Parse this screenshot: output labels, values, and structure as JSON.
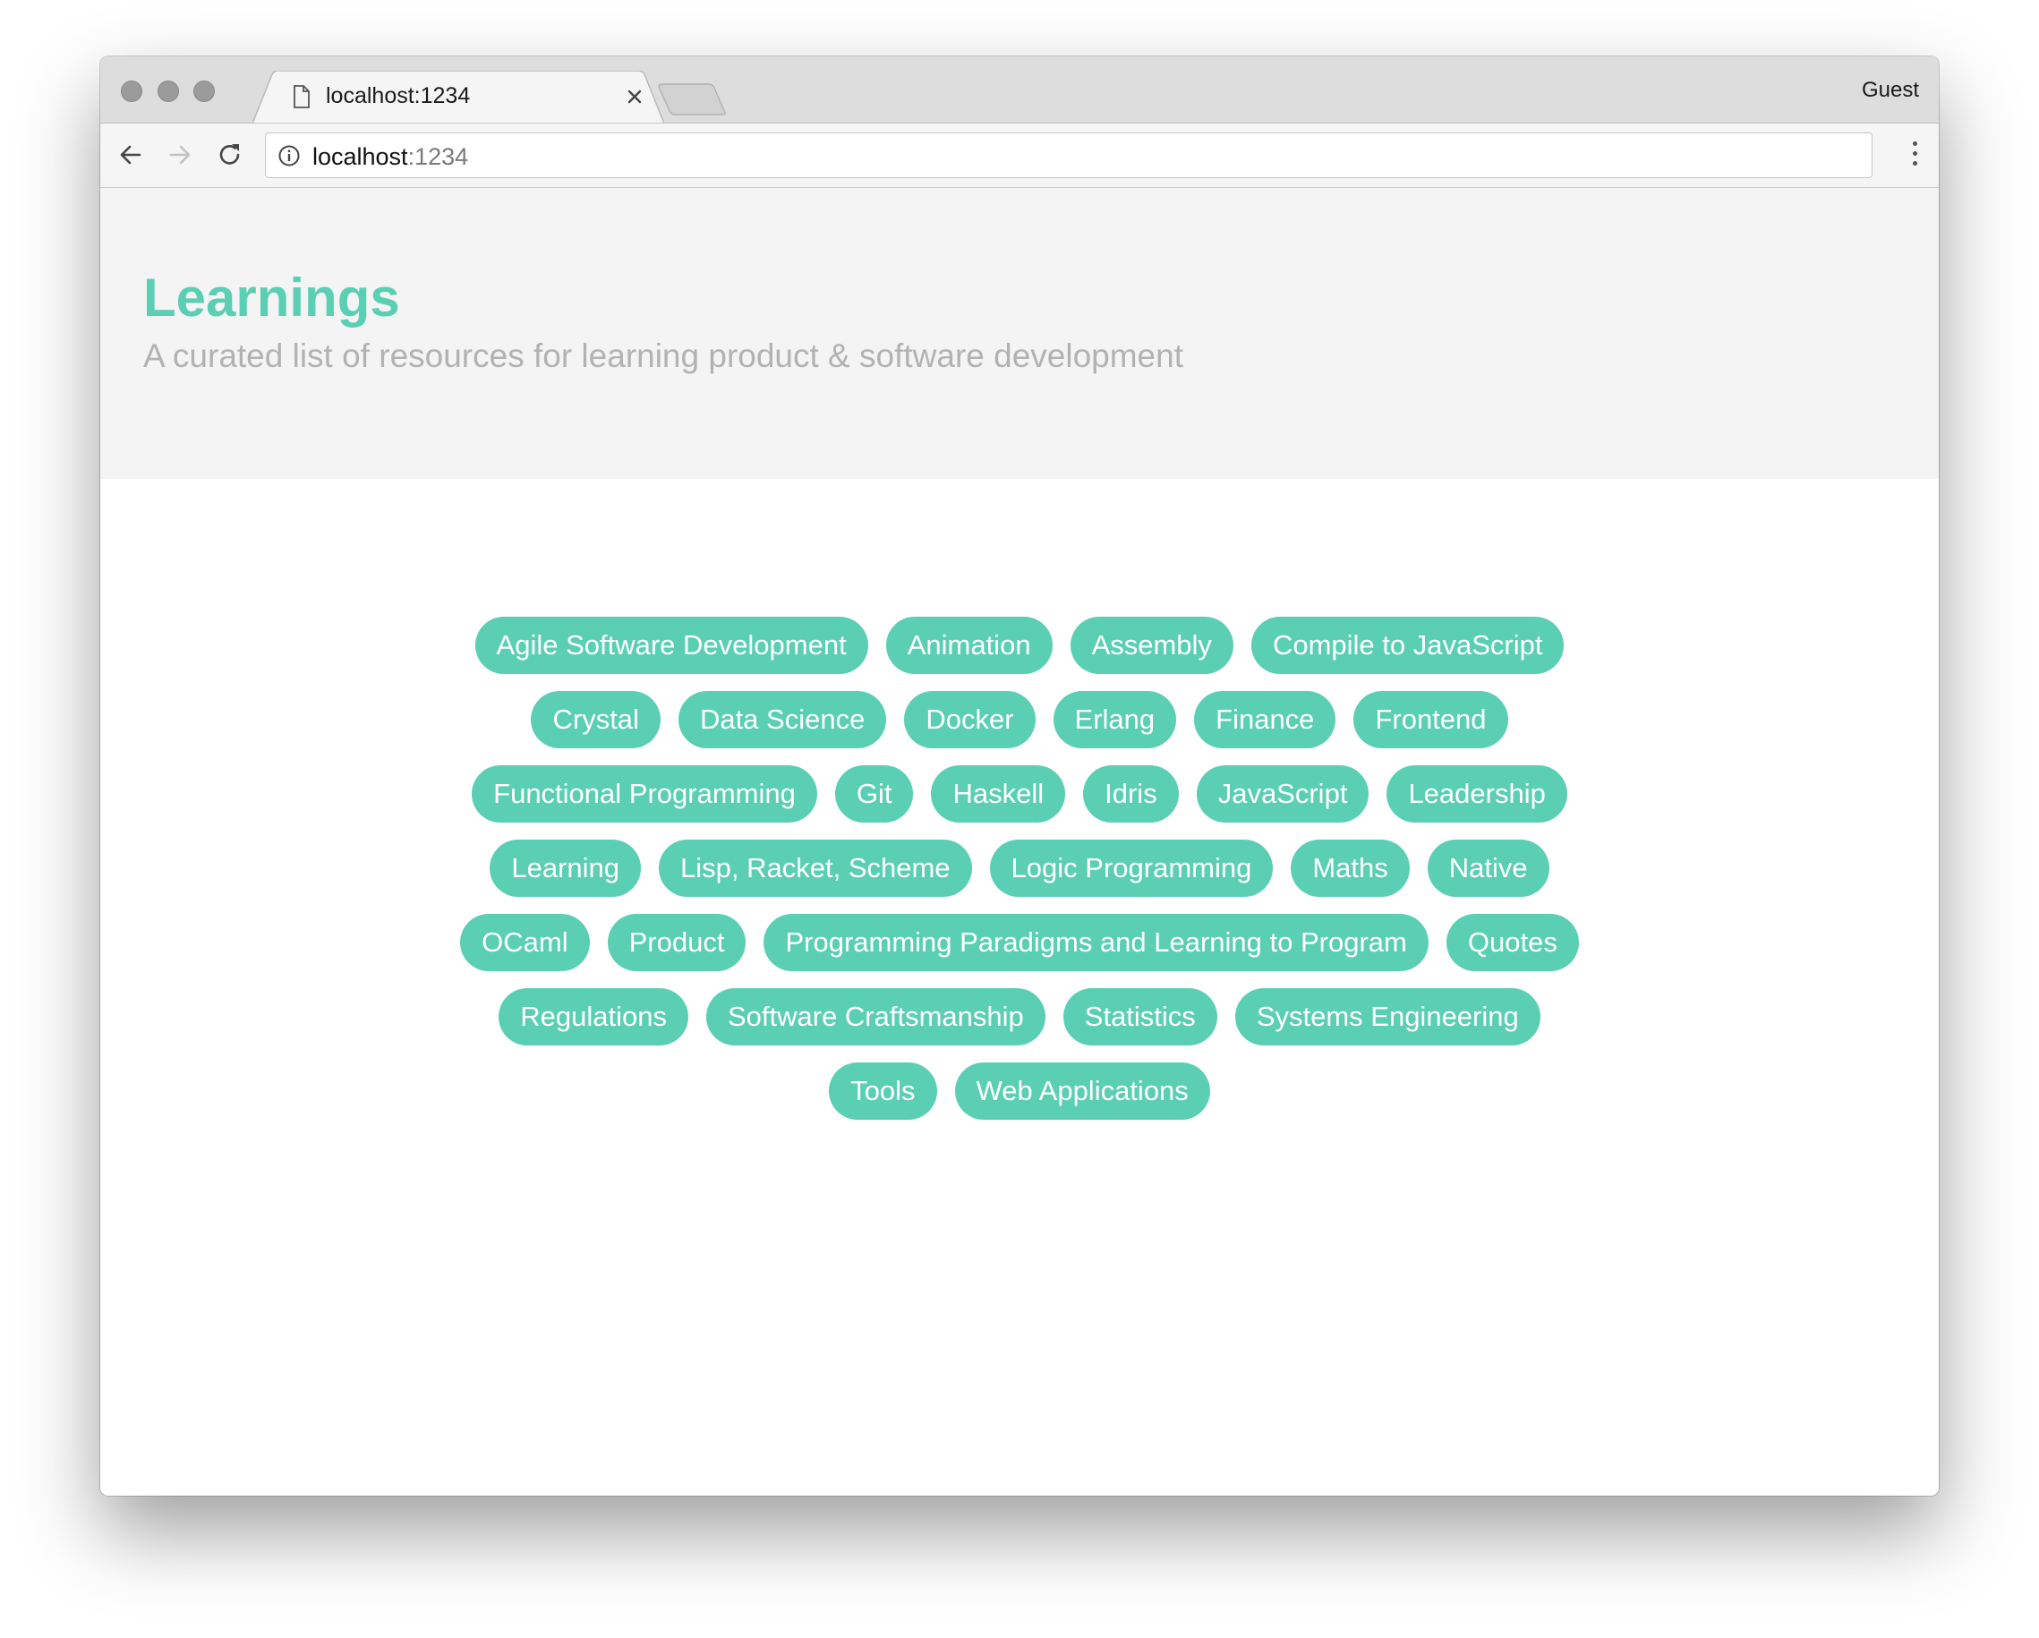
{
  "browser": {
    "tab_title": "localhost:1234",
    "profile_label": "Guest",
    "url_host": "localhost",
    "url_port": ":1234"
  },
  "page": {
    "title": "Learnings",
    "subtitle": "A curated list of resources for learning product & software development",
    "accent_color": "#5bcfb3",
    "tags": [
      "Agile Software Development",
      "Animation",
      "Assembly",
      "Compile to JavaScript",
      "Crystal",
      "Data Science",
      "Docker",
      "Erlang",
      "Finance",
      "Frontend",
      "Functional Programming",
      "Git",
      "Haskell",
      "Idris",
      "JavaScript",
      "Leadership",
      "Learning",
      "Lisp, Racket, Scheme",
      "Logic Programming",
      "Maths",
      "Native",
      "OCaml",
      "Product",
      "Programming Paradigms and Learning to Program",
      "Quotes",
      "Regulations",
      "Software Craftsmanship",
      "Statistics",
      "Systems Engineering",
      "Tools",
      "Web Applications"
    ]
  },
  "icons": {
    "tab": "document-icon",
    "close": "close-icon",
    "back": "arrow-left-icon",
    "forward": "arrow-right-icon",
    "reload": "reload-icon",
    "info": "info-icon",
    "menu": "more-vertical-icon"
  }
}
